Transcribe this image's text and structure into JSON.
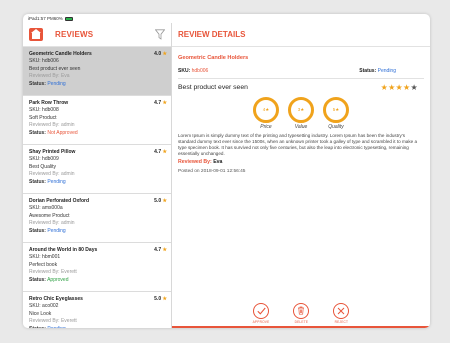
{
  "status_bar": {
    "device": "iPad",
    "time": "1:57 PM",
    "battery_pct": "60%"
  },
  "colors": {
    "accent": "#e8553a",
    "star": "#f0a31c",
    "pending": "#2f6fd6",
    "approved": "#2ea043"
  },
  "left_panel": {
    "title": "REVIEWS",
    "items": [
      {
        "name": "Geometric Candle Holders",
        "rating": "4.0",
        "sku": "SKU: hdb006",
        "text": "Best product ever seen",
        "reviewed_by": "Reviewed By: Eva",
        "status_label": "Status:",
        "status": "Pending",
        "status_kind": "pending",
        "selected": true
      },
      {
        "name": "Park Row Throw",
        "rating": "4.7",
        "sku": "SKU: hdb008",
        "text": "Soft Product",
        "reviewed_by": "Reviewed By: admin",
        "status_label": "Status:",
        "status": "Not Approved",
        "status_kind": "notapp",
        "selected": false
      },
      {
        "name": "Shay Printed Pillow",
        "rating": "4.7",
        "sku": "SKU: hdb009",
        "text": "Best Quality",
        "reviewed_by": "Reviewed By: admin",
        "status_label": "Status:",
        "status": "Pending",
        "status_kind": "pending",
        "selected": false
      },
      {
        "name": "Dorian Perforated Oxford",
        "rating": "5.0",
        "sku": "SKU: ams000a",
        "text": "Awesome Product",
        "reviewed_by": "Reviewed By: admin",
        "status_label": "Status:",
        "status": "Pending",
        "status_kind": "pending",
        "selected": false
      },
      {
        "name": "Around the World in 80 Days",
        "rating": "4.7",
        "sku": "SKU: hbm001",
        "text": "Perfect book",
        "reviewed_by": "Reviewed By: Everett",
        "status_label": "Status:",
        "status": "Approved",
        "status_kind": "approved",
        "selected": false
      },
      {
        "name": "Retro Chic Eyeglasses",
        "rating": "5.0",
        "sku": "SKU: aco002",
        "text": "Nice Look",
        "reviewed_by": "Reviewed By: Everett",
        "status_label": "Status:",
        "status": "Pending",
        "status_kind": "pending",
        "selected": false
      }
    ]
  },
  "detail": {
    "title": "REVIEW DETAILS",
    "product_name": "Geometric Candle Holders",
    "sku_label": "SKU:",
    "sku": "hdb006",
    "status_label": "Status:",
    "status": "Pending",
    "review_text": "Best product ever seen",
    "rating_stars": 4,
    "rating_max": 5,
    "scores": [
      {
        "value": "4",
        "label": "Price"
      },
      {
        "value": "3",
        "label": "Value"
      },
      {
        "value": "5",
        "label": "Quality"
      }
    ],
    "description": "Lorem Ipsum is simply dummy text of the printing and typesetting industry. Lorem Ipsum has been the industry's standard dummy text ever since the 1500s, when an unknown printer took a galley of type and scrambled it to make a type specimen book. It has survived not only five centuries, but also the leap into electronic typesetting, remaining essentially unchanged.",
    "reviewed_by_label": "Reviewed By:",
    "reviewed_by": "Eva",
    "posted_on": "Posted on 2018-09-01 12:56:45"
  },
  "actions": {
    "approve": "APPROVE",
    "delete": "DELETE",
    "reject": "REJECT"
  }
}
